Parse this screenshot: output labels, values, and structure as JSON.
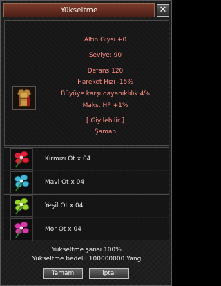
{
  "window": {
    "title": "Yükseltme",
    "close_glyph": "✕"
  },
  "item": {
    "icon": "armor-icon",
    "name": "Altın Giysi +0",
    "level": "Seviye: 90",
    "defense": "Defans 120",
    "stats": [
      "Hareket Hızı -15%",
      "Büyüye karşı dayanıklılık 4%",
      "Maks. HP +1%"
    ],
    "wearable": "[ Giyilebilir ]",
    "class": "Şaman"
  },
  "materials": [
    {
      "label": "Kırmızı Ot x 04",
      "icon": "red-herb-icon",
      "color": "#e0203a"
    },
    {
      "label": "Mavi Ot x 04",
      "icon": "blue-herb-icon",
      "color": "#40b8d8"
    },
    {
      "label": "Yeşil Ot x 04",
      "icon": "green-herb-icon",
      "color": "#9ad62a"
    },
    {
      "label": "Mor Ot x 04",
      "icon": "purple-herb-icon",
      "color": "#d63aa6"
    }
  ],
  "footer": {
    "chance": "Yükseltme şansı 100%",
    "cost": "Yükseltme bedeli: 100000000 Yang",
    "confirm_label": "Tamam",
    "cancel_label": "iptal"
  },
  "colors": {
    "title_bar": "#6a2f24",
    "stat_text": "#ff8f86",
    "normal_text": "#e6e6e6"
  }
}
